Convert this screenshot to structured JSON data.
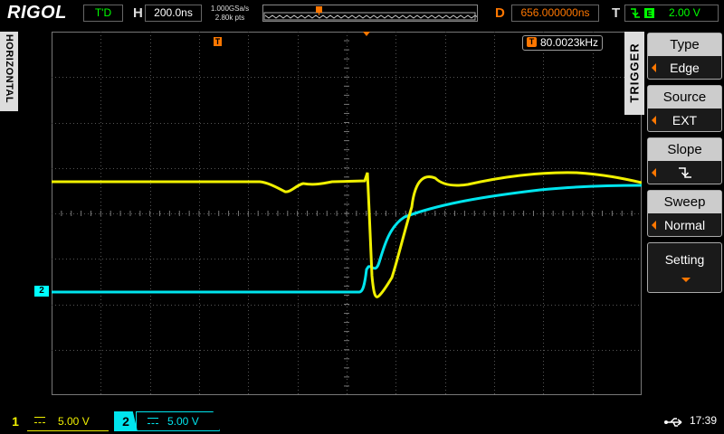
{
  "brand": "RIGOL",
  "status": "T'D",
  "horizontal": {
    "label": "H",
    "timebase": "200.0ns"
  },
  "sample": {
    "rate": "1.000GSa/s",
    "points": "2.80k pts"
  },
  "delay": {
    "label": "D",
    "value": "656.000000ns"
  },
  "trigger_status": {
    "label": "T",
    "level": "2.00 V"
  },
  "frequency_counter": {
    "icon": "T",
    "value": "80.0023kHz"
  },
  "tabs": {
    "horizontal": "HORIZONTAL",
    "trigger": "TRIGGER"
  },
  "menu": [
    {
      "title": "Type",
      "value": "Edge"
    },
    {
      "title": "Source",
      "value": "EXT"
    },
    {
      "title": "Slope",
      "value": "falling-edge-icon"
    },
    {
      "title": "Sweep",
      "value": "Normal"
    },
    {
      "title": "Setting",
      "value": ""
    }
  ],
  "channels": [
    {
      "number": "1",
      "scale": "5.00 V",
      "color": "#f0f000"
    },
    {
      "number": "2",
      "scale": "5.00 V",
      "color": "#00e5ee"
    }
  ],
  "ch2_marker": "2",
  "clock": "17:39",
  "colors": {
    "ch1": "#f0f000",
    "ch2": "#00e5ee",
    "accent": "#ff7a00",
    "status": "#00ff00"
  }
}
